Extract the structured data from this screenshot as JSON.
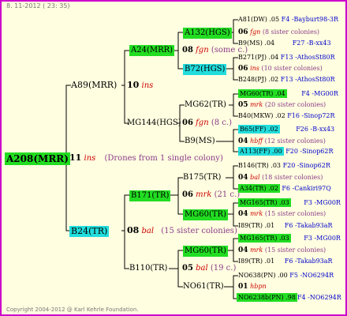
{
  "header": {
    "date": "8. 11-2012 ( 23: 35)"
  },
  "footer": {
    "copyright": "Copyright 2004-2012 @ Karl Kehrle Foundation."
  },
  "root": {
    "id": "A208(MRR)",
    "ins_num": "11",
    "ins": "ins",
    "note": "(Drones from 1 single colony)"
  },
  "gen1": {
    "sire": {
      "id": "A89(MRR)",
      "ins_num": "10",
      "ins": "ins"
    },
    "dam": {
      "id": "B24(TR)",
      "ins_num": "08",
      "ins": "bal",
      "note": "(15 sister colonies)"
    }
  },
  "gen2": {
    "a24": {
      "id": "A24(MRR)",
      "ins_num": "08",
      "ins": "fgn",
      "note": "(some c.)"
    },
    "mg144": {
      "id": "MG144(HGS)",
      "ins_num": "06",
      "ins": "fgn",
      "note": "(8 c.)"
    },
    "b171": {
      "id": "B171(TR)",
      "ins_num": "06",
      "ins": "mrk",
      "note": "(21 c.)"
    },
    "b110": {
      "id": "B110(TR)",
      "ins_num": "05",
      "ins": "bal",
      "note": "(19 c.)"
    }
  },
  "gen3": [
    {
      "id": "A132(HGS)",
      "ins_num": "06",
      "ins": "fgn",
      "note": "(8 sister colonies)",
      "style": "g"
    },
    {
      "id": "B72(HGS)",
      "ins_num": "06",
      "ins": "ins",
      "note": "(10 sister colonies)",
      "style": "c"
    },
    {
      "id": "MG62(TR)",
      "ins_num": "05",
      "ins": "mrk",
      "note": "(20 sister colonies)",
      "style": ""
    },
    {
      "id": "B9(MS)",
      "ins_num": "04",
      "ins": "hbff",
      "note": "(12 sister colonies)",
      "style": ""
    },
    {
      "id": "B175(TR)",
      "ins_num": "04",
      "ins": "bal",
      "note": "(18 sister colonies)",
      "style": ""
    },
    {
      "id": "MG60(TR)",
      "ins_num": "04",
      "ins": "mrk",
      "note": "(15 sister colonies)",
      "style": "g"
    },
    {
      "id": "MG60(TR)",
      "ins_num": "04",
      "ins": "mrk",
      "note": "(15 sister colonies)",
      "style": "g"
    },
    {
      "id": "NO61(TR)",
      "ins_num": "01",
      "ins": "hbpn",
      "note": "",
      "style": ""
    }
  ],
  "gen4": [
    {
      "id": "A81(DW) .05",
      "tag": "F4 -Bayburt98-3R",
      "style": ""
    },
    {
      "id": "B9(MS) .04",
      "tag": "F27 -B-xx43",
      "style": ""
    },
    {
      "id": "B271(PJ) .04",
      "tag": "F13 -AthosSt80R",
      "style": ""
    },
    {
      "id": "B248(PJ) .02",
      "tag": "F13 -AthosSt80R",
      "style": ""
    },
    {
      "id": "MG60(TR) .04",
      "tag": "F4 -MG00R",
      "style": "g"
    },
    {
      "id": "B40(MKW) .02",
      "tag": "F16 -Sinop72R",
      "style": ""
    },
    {
      "id": "B65(FF) .02",
      "tag": "F26 -B-xx43",
      "style": "c"
    },
    {
      "id": "A113(FF) .00",
      "tag": "F20 -Sinop62R",
      "style": "c"
    },
    {
      "id": "B146(TR) .03",
      "tag": "F20 -Sinop62R",
      "style": ""
    },
    {
      "id": "A34(TR) .02",
      "tag": "F6 -Cankiri97Q",
      "style": "g"
    },
    {
      "id": "MG165(TR) .03",
      "tag": "F3 -MG00R",
      "style": "g"
    },
    {
      "id": "I89(TR) .01",
      "tag": "F6 -Takab93aR",
      "style": ""
    },
    {
      "id": "MG165(TR) .03",
      "tag": "F3 -MG00R",
      "style": "g"
    },
    {
      "id": "I89(TR) .01",
      "tag": "F6 -Takab93aR",
      "style": ""
    },
    {
      "id": "NO638(PN) .00",
      "tag": "F5 -NO6294R",
      "style": ""
    },
    {
      "id": "NO6238b(PN) .98",
      "tag": "F4 -NO6294R",
      "style": "g"
    }
  ]
}
